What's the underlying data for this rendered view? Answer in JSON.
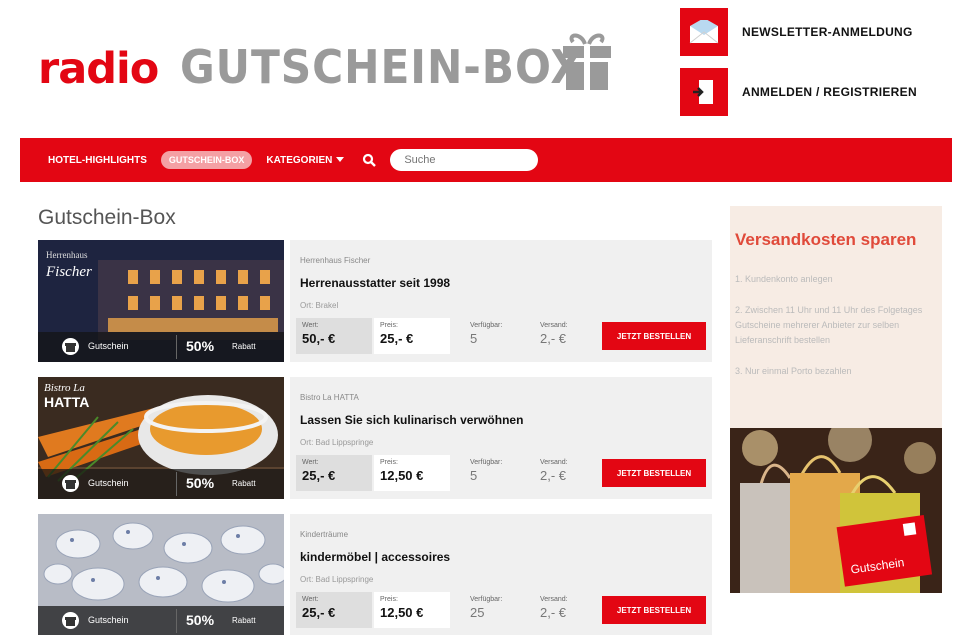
{
  "header": {
    "logo_radio": "radio",
    "logo_title": "GUTSCHEIN-BOX",
    "newsletter_link": "NEWSLETTER-ANMELDUNG",
    "login_link": "ANMELDEN / REGISTRIEREN"
  },
  "nav": {
    "items": [
      "HOTEL-HIGHLIGHTS",
      "GUTSCHEIN-BOX",
      "KATEGORIEN"
    ],
    "active_index": 1,
    "search_placeholder": "Suche"
  },
  "page_title": "Gutschein-Box",
  "products": [
    {
      "image_caption": "Fischer",
      "vendor": "Herrenhaus Fischer",
      "headline": "Herrenausstatter seit 1998",
      "ort": "Ort: Brakel",
      "labels": {
        "wert": "Wert:",
        "preis": "Preis:",
        "verfuegbar": "Verfügbar:",
        "versand": "Versand:"
      },
      "wert": "50,- €",
      "preis": "25,- €",
      "verfuegbar": "5",
      "versand": "2,- €",
      "badge_label": "Gutschein",
      "discount": "50%",
      "discount_label": "Rabatt",
      "button": "JETZT BESTELLEN"
    },
    {
      "image_caption": "Bistro La HATTA",
      "vendor": "Bistro La HATTA",
      "headline": "Lassen Sie sich kulinarisch verwöhnen",
      "ort": "Ort: Bad Lippspringe",
      "labels": {
        "wert": "Wert:",
        "preis": "Preis:",
        "verfuegbar": "Verfügbar:",
        "versand": "Versand:"
      },
      "wert": "25,- €",
      "preis": "12,50 €",
      "verfuegbar": "5",
      "versand": "2,- €",
      "badge_label": "Gutschein",
      "discount": "50%",
      "discount_label": "Rabatt",
      "button": "JETZT BESTELLEN"
    },
    {
      "image_caption": "",
      "vendor": "Kinderträume",
      "headline": "kindermöbel | accessoires",
      "ort": "Ort: Bad Lippspringe",
      "labels": {
        "wert": "Wert:",
        "preis": "Preis:",
        "verfuegbar": "Verfügbar:",
        "versand": "Versand:"
      },
      "wert": "25,- €",
      "preis": "12,50 €",
      "verfuegbar": "25",
      "versand": "2,- €",
      "badge_label": "Gutschein",
      "discount": "50%",
      "discount_label": "Rabatt",
      "button": "JETZT BESTELLEN"
    }
  ],
  "sidebar": {
    "title": "Versandkosten sparen",
    "steps": [
      "1. Kundenkonto anlegen",
      "2. Zwischen 11 Uhr und 11 Uhr des Folgetages Gutscheine mehrerer Anbieter zur selben Lieferanschrift bestellen",
      "3. Nur einmal Porto bezahlen"
    ],
    "bag_label": "Gutschein"
  },
  "colors": {
    "brand_red": "#e30613",
    "title_gray": "#9a9a9a",
    "card_bg": "#f0f0f0",
    "sidebar_bg": "#f7ece4",
    "sidebar_title": "#e04a3a"
  }
}
